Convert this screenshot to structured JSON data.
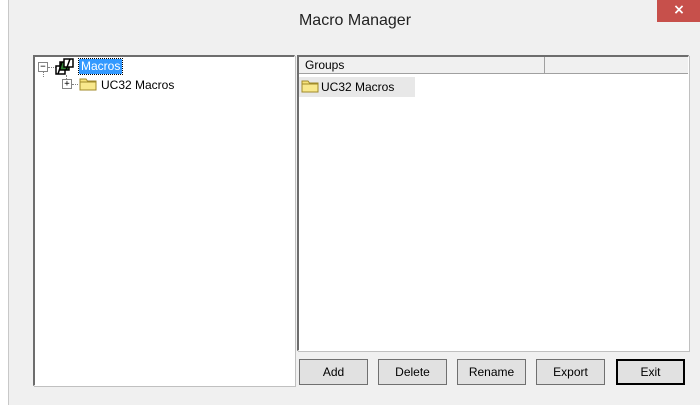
{
  "window": {
    "title": "Macro Manager"
  },
  "titlebar": {
    "close_label": "×"
  },
  "tree": {
    "root": {
      "label": "Macros",
      "expander": "−",
      "icon": "macros-icon"
    },
    "children": [
      {
        "label": "UC32 Macros",
        "expander": "+",
        "icon": "folder-icon"
      }
    ]
  },
  "list": {
    "columns": [
      "Groups",
      ""
    ],
    "items": [
      {
        "label": "UC32 Macros",
        "icon": "folder-icon"
      }
    ]
  },
  "buttons": {
    "add": "Add",
    "delete": "Delete",
    "rename": "Rename",
    "export": "Export",
    "exit": "Exit"
  },
  "colors": {
    "selection": "#3399ff",
    "close_button": "#c7504b",
    "folder": "#f6e27a"
  }
}
